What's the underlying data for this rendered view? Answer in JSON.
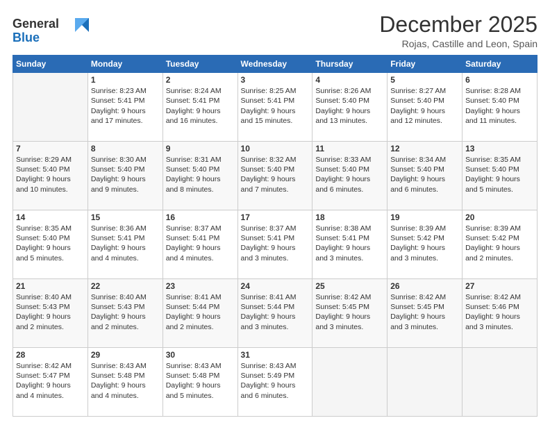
{
  "logo": {
    "line1": "General",
    "line2": "Blue"
  },
  "header": {
    "month": "December 2025",
    "location": "Rojas, Castille and Leon, Spain"
  },
  "weekdays": [
    "Sunday",
    "Monday",
    "Tuesday",
    "Wednesday",
    "Thursday",
    "Friday",
    "Saturday"
  ],
  "weeks": [
    [
      {
        "day": "",
        "info": ""
      },
      {
        "day": "1",
        "info": "Sunrise: 8:23 AM\nSunset: 5:41 PM\nDaylight: 9 hours\nand 17 minutes."
      },
      {
        "day": "2",
        "info": "Sunrise: 8:24 AM\nSunset: 5:41 PM\nDaylight: 9 hours\nand 16 minutes."
      },
      {
        "day": "3",
        "info": "Sunrise: 8:25 AM\nSunset: 5:41 PM\nDaylight: 9 hours\nand 15 minutes."
      },
      {
        "day": "4",
        "info": "Sunrise: 8:26 AM\nSunset: 5:40 PM\nDaylight: 9 hours\nand 13 minutes."
      },
      {
        "day": "5",
        "info": "Sunrise: 8:27 AM\nSunset: 5:40 PM\nDaylight: 9 hours\nand 12 minutes."
      },
      {
        "day": "6",
        "info": "Sunrise: 8:28 AM\nSunset: 5:40 PM\nDaylight: 9 hours\nand 11 minutes."
      }
    ],
    [
      {
        "day": "7",
        "info": "Sunrise: 8:29 AM\nSunset: 5:40 PM\nDaylight: 9 hours\nand 10 minutes."
      },
      {
        "day": "8",
        "info": "Sunrise: 8:30 AM\nSunset: 5:40 PM\nDaylight: 9 hours\nand 9 minutes."
      },
      {
        "day": "9",
        "info": "Sunrise: 8:31 AM\nSunset: 5:40 PM\nDaylight: 9 hours\nand 8 minutes."
      },
      {
        "day": "10",
        "info": "Sunrise: 8:32 AM\nSunset: 5:40 PM\nDaylight: 9 hours\nand 7 minutes."
      },
      {
        "day": "11",
        "info": "Sunrise: 8:33 AM\nSunset: 5:40 PM\nDaylight: 9 hours\nand 6 minutes."
      },
      {
        "day": "12",
        "info": "Sunrise: 8:34 AM\nSunset: 5:40 PM\nDaylight: 9 hours\nand 6 minutes."
      },
      {
        "day": "13",
        "info": "Sunrise: 8:35 AM\nSunset: 5:40 PM\nDaylight: 9 hours\nand 5 minutes."
      }
    ],
    [
      {
        "day": "14",
        "info": "Sunrise: 8:35 AM\nSunset: 5:40 PM\nDaylight: 9 hours\nand 5 minutes."
      },
      {
        "day": "15",
        "info": "Sunrise: 8:36 AM\nSunset: 5:41 PM\nDaylight: 9 hours\nand 4 minutes."
      },
      {
        "day": "16",
        "info": "Sunrise: 8:37 AM\nSunset: 5:41 PM\nDaylight: 9 hours\nand 4 minutes."
      },
      {
        "day": "17",
        "info": "Sunrise: 8:37 AM\nSunset: 5:41 PM\nDaylight: 9 hours\nand 3 minutes."
      },
      {
        "day": "18",
        "info": "Sunrise: 8:38 AM\nSunset: 5:41 PM\nDaylight: 9 hours\nand 3 minutes."
      },
      {
        "day": "19",
        "info": "Sunrise: 8:39 AM\nSunset: 5:42 PM\nDaylight: 9 hours\nand 3 minutes."
      },
      {
        "day": "20",
        "info": "Sunrise: 8:39 AM\nSunset: 5:42 PM\nDaylight: 9 hours\nand 2 minutes."
      }
    ],
    [
      {
        "day": "21",
        "info": "Sunrise: 8:40 AM\nSunset: 5:43 PM\nDaylight: 9 hours\nand 2 minutes."
      },
      {
        "day": "22",
        "info": "Sunrise: 8:40 AM\nSunset: 5:43 PM\nDaylight: 9 hours\nand 2 minutes."
      },
      {
        "day": "23",
        "info": "Sunrise: 8:41 AM\nSunset: 5:44 PM\nDaylight: 9 hours\nand 2 minutes."
      },
      {
        "day": "24",
        "info": "Sunrise: 8:41 AM\nSunset: 5:44 PM\nDaylight: 9 hours\nand 3 minutes."
      },
      {
        "day": "25",
        "info": "Sunrise: 8:42 AM\nSunset: 5:45 PM\nDaylight: 9 hours\nand 3 minutes."
      },
      {
        "day": "26",
        "info": "Sunrise: 8:42 AM\nSunset: 5:45 PM\nDaylight: 9 hours\nand 3 minutes."
      },
      {
        "day": "27",
        "info": "Sunrise: 8:42 AM\nSunset: 5:46 PM\nDaylight: 9 hours\nand 3 minutes."
      }
    ],
    [
      {
        "day": "28",
        "info": "Sunrise: 8:42 AM\nSunset: 5:47 PM\nDaylight: 9 hours\nand 4 minutes."
      },
      {
        "day": "29",
        "info": "Sunrise: 8:43 AM\nSunset: 5:48 PM\nDaylight: 9 hours\nand 4 minutes."
      },
      {
        "day": "30",
        "info": "Sunrise: 8:43 AM\nSunset: 5:48 PM\nDaylight: 9 hours\nand 5 minutes."
      },
      {
        "day": "31",
        "info": "Sunrise: 8:43 AM\nSunset: 5:49 PM\nDaylight: 9 hours\nand 6 minutes."
      },
      {
        "day": "",
        "info": ""
      },
      {
        "day": "",
        "info": ""
      },
      {
        "day": "",
        "info": ""
      }
    ]
  ]
}
